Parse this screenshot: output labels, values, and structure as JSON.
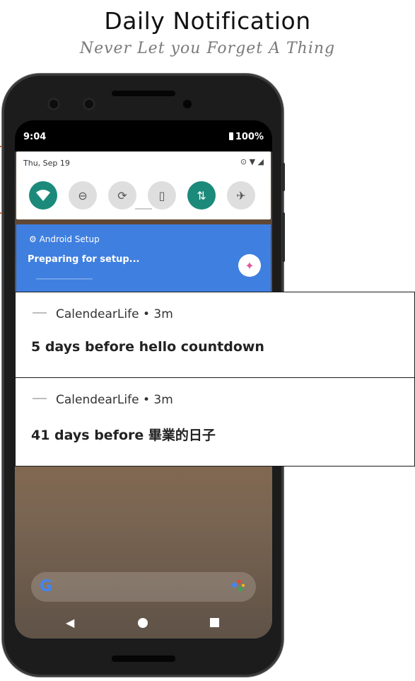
{
  "header": {
    "title": "Daily Notification",
    "subtitle": "Never Let you Forget A Thing"
  },
  "status_bar": {
    "time": "9:04",
    "battery": "100%"
  },
  "quick_settings": {
    "date": "Thu, Sep 19",
    "tiles": [
      {
        "name": "wifi",
        "on": true
      },
      {
        "name": "do-not-disturb",
        "on": false
      },
      {
        "name": "auto-rotate",
        "on": false
      },
      {
        "name": "battery-saver",
        "on": false
      },
      {
        "name": "mobile-data",
        "on": true
      },
      {
        "name": "airplane-mode",
        "on": false
      }
    ]
  },
  "setup_notification": {
    "app": "Android Setup",
    "text": "Preparing for setup..."
  },
  "notifications": [
    {
      "app": "CalendearLife",
      "age": "3m",
      "title": "5 days before hello countdown"
    },
    {
      "app": "CalendearLife",
      "age": "3m",
      "title": "41 days before 畢業的日子"
    }
  ],
  "colors": {
    "tile_on": "#1b8a7a",
    "setup_blue": "#3f7fe0"
  }
}
